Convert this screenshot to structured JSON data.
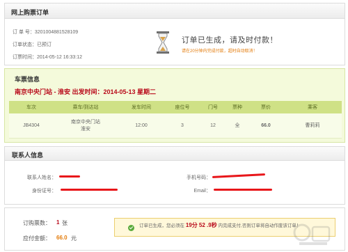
{
  "order": {
    "title": "网上购票订单",
    "number_label": "订 单 号：3201004881528109",
    "status_label": "订单状态：已预订",
    "time_label": "订票时间：2014-05-12 16:33:12",
    "status_title": "订单已生成，请及时付款！",
    "status_note": "请在20分钟内完成付款，超时自动取消！"
  },
  "ticket": {
    "title": "车票信息",
    "route": "南京中央门站 - 淮安   出发时间：2014-05-13 星期二",
    "columns": [
      "车次",
      "乘车/到达站",
      "发车时间",
      "座位号",
      "门号",
      "票种",
      "票价",
      "乘客"
    ],
    "row": {
      "train": "JB4304",
      "from": "南京中央门站",
      "to": "淮安",
      "time": "12:00",
      "seat": "3",
      "gate": "12",
      "type": "全",
      "price": "66.0",
      "passenger": "曹莉莉"
    }
  },
  "contact": {
    "title": "联系人信息",
    "name_label": "联系人姓名：",
    "id_label": "身份证号：",
    "phone_label": "手机号码：",
    "email_label": "Email："
  },
  "payment": {
    "count_label": "订购票数：",
    "count_value": "1",
    "count_unit": "张",
    "amount_label": "应付金额：",
    "amount_value": "66.0",
    "amount_unit": "元",
    "notice_pre": "订单已生成，您必须在",
    "notice_min": "19分 52 .9秒",
    "notice_post": "内完成支付,否则订单将自动作废该订单！"
  },
  "colors": {
    "accent_red": "#b8091a",
    "accent_orange": "#e37b0b",
    "table_header": "#cfe186",
    "notice_bg": "#fff8da",
    "redaction": "#e8161a"
  }
}
